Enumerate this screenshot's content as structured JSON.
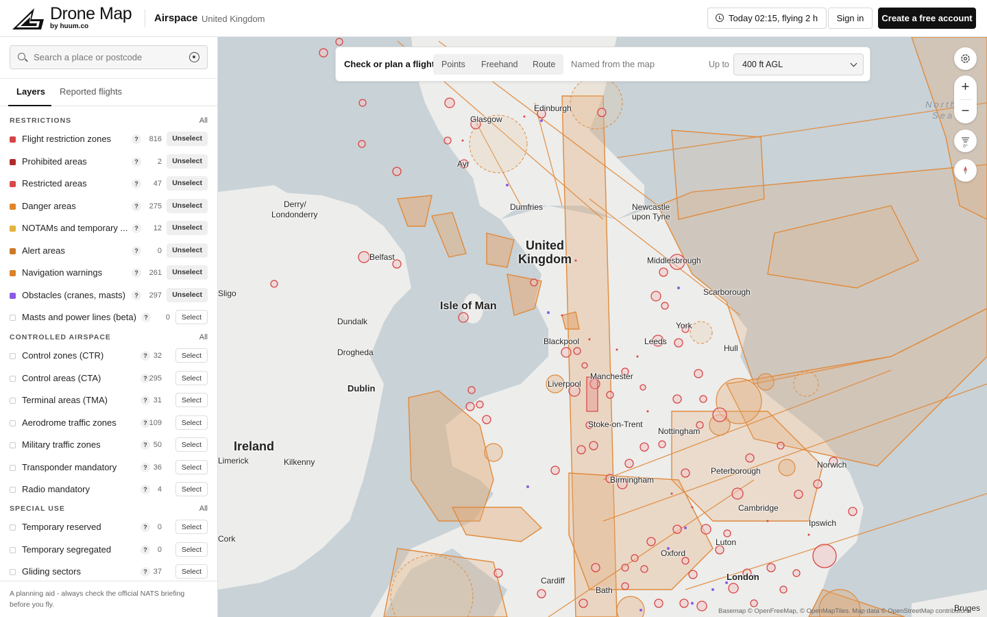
{
  "header": {
    "brand_name": "Drone Map",
    "brand_by": "by huum.co",
    "section": "Airspace",
    "region": "United Kingdom",
    "time_button": "Today 02:15, flying 2 h",
    "signin": "Sign in",
    "create_account": "Create a free account"
  },
  "search": {
    "placeholder": "Search a place or postcode"
  },
  "tabs": [
    "Layers",
    "Reported flights"
  ],
  "groups": {
    "restrictions": {
      "title": "RESTRICTIONS",
      "all": "All",
      "items": [
        {
          "label": "Flight restriction zones",
          "count": "816",
          "action": "Unselect",
          "color": "#d64545"
        },
        {
          "label": "Prohibited areas",
          "count": "2",
          "action": "Unselect",
          "color": "#b02a2a"
        },
        {
          "label": "Restricted areas",
          "count": "47",
          "action": "Unselect",
          "color": "#d94848"
        },
        {
          "label": "Danger areas",
          "count": "275",
          "action": "Unselect",
          "color": "#e0852c"
        },
        {
          "label": "NOTAMs and temporary ...",
          "count": "12",
          "action": "Unselect",
          "color": "#e3b53c"
        },
        {
          "label": "Alert areas",
          "count": "0",
          "action": "Unselect",
          "color": "#cc7a2a"
        },
        {
          "label": "Navigation warnings",
          "count": "261",
          "action": "Unselect",
          "color": "#d9822b"
        },
        {
          "label": "Obstacles (cranes, masts)",
          "count": "297",
          "action": "Unselect",
          "color": "#8a5ce6"
        },
        {
          "label": "Masts and power lines (beta)",
          "count": "0",
          "action": "Select",
          "color": ""
        }
      ]
    },
    "controlled": {
      "title": "CONTROLLED AIRSPACE",
      "all": "All",
      "items": [
        {
          "label": "Control zones (CTR)",
          "count": "32",
          "action": "Select"
        },
        {
          "label": "Control areas (CTA)",
          "count": "295",
          "action": "Select"
        },
        {
          "label": "Terminal areas (TMA)",
          "count": "31",
          "action": "Select"
        },
        {
          "label": "Aerodrome traffic zones",
          "count": "109",
          "action": "Select"
        },
        {
          "label": "Military traffic zones",
          "count": "50",
          "action": "Select"
        },
        {
          "label": "Transponder mandatory",
          "count": "36",
          "action": "Select"
        },
        {
          "label": "Radio mandatory",
          "count": "4",
          "action": "Select"
        }
      ]
    },
    "special": {
      "title": "SPECIAL USE",
      "all": "All",
      "items": [
        {
          "label": "Temporary reserved",
          "count": "0",
          "action": "Select"
        },
        {
          "label": "Temporary segregated",
          "count": "0",
          "action": "Select"
        },
        {
          "label": "Gliding sectors",
          "count": "37",
          "action": "Select"
        }
      ]
    }
  },
  "footer_note": "A planning aid - always check the official NATS briefing before you fly.",
  "plan_bar": {
    "title": "Check or plan a flight",
    "modes": [
      "Points",
      "Freehand",
      "Route"
    ],
    "hint": "Named from the map",
    "upto": "Up to",
    "altitude": "400 ft AGL"
  },
  "map": {
    "attribution": "Basemap © OpenFreeMap, © OpenMapTiles. Map data © OpenStreetMap contributors.",
    "country_uk": [
      "United",
      "Kingdom"
    ],
    "country_ie": "Ireland",
    "sea": [
      "North",
      "Sea"
    ],
    "isle": "Isle of Man",
    "cities": [
      {
        "name": "Edinburgh"
      },
      {
        "name": "Glasgow"
      },
      {
        "name": "Ayr"
      },
      {
        "name": "Derry/"
      },
      {
        "name": "Londonderry"
      },
      {
        "name": "Dumfries"
      },
      {
        "name": "Newcastle"
      },
      {
        "name": "upon Tyne"
      },
      {
        "name": "Belfast"
      },
      {
        "name": "Middlesbrough"
      },
      {
        "name": "Sligo"
      },
      {
        "name": "Scarborough"
      },
      {
        "name": "Dundalk"
      },
      {
        "name": "York"
      },
      {
        "name": "Blackpool"
      },
      {
        "name": "Leeds"
      },
      {
        "name": "Hull"
      },
      {
        "name": "Drogheda"
      },
      {
        "name": "Dublin"
      },
      {
        "name": "Liverpool"
      },
      {
        "name": "Manchester"
      },
      {
        "name": "Stoke-on-Trent"
      },
      {
        "name": "Nottingham"
      },
      {
        "name": "Kilkenny"
      },
      {
        "name": "Birmingham"
      },
      {
        "name": "Peterborough"
      },
      {
        "name": "Norwich"
      },
      {
        "name": "Cambridge"
      },
      {
        "name": "Ipswich"
      },
      {
        "name": "Luton"
      },
      {
        "name": "Oxford"
      },
      {
        "name": "London"
      },
      {
        "name": "Cardiff"
      },
      {
        "name": "Bath"
      },
      {
        "name": "Cork"
      },
      {
        "name": "Limerick"
      },
      {
        "name": "Bruges"
      }
    ]
  },
  "colors": {
    "accent": "#111111",
    "zone_fill": "#e3a874",
    "zone_stroke": "#e08a3c",
    "frz": "#d64545",
    "obstacle": "#8a5ce6"
  }
}
